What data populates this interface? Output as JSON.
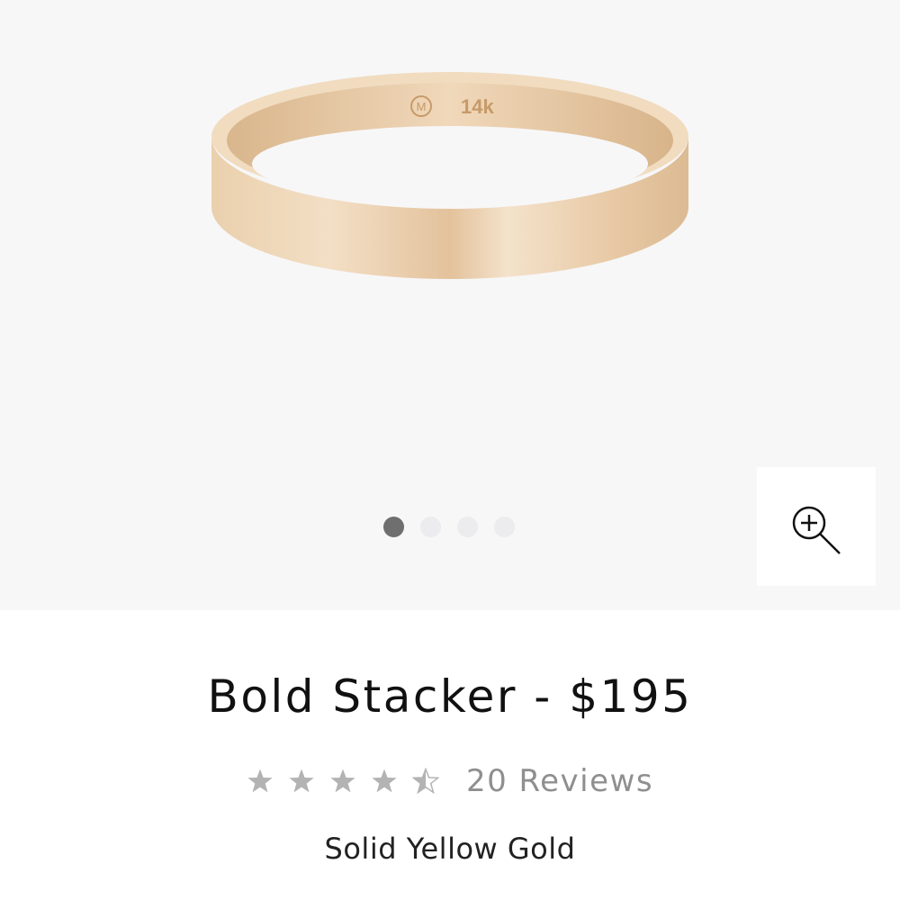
{
  "gallery": {
    "engraving": {
      "logo": "M",
      "karat": "14k"
    },
    "dots": [
      {
        "label": "Image 1",
        "active": true
      },
      {
        "label": "Image 2",
        "active": false
      },
      {
        "label": "Image 3",
        "active": false
      },
      {
        "label": "Image 4",
        "active": false
      }
    ],
    "zoom_icon": "zoom-in-icon"
  },
  "product": {
    "title": "Bold Stacker - $195",
    "rating": 4.5,
    "max_rating": 5,
    "reviews_label": "20 Reviews",
    "variant": "Solid Yellow Gold"
  },
  "colors": {
    "gallery_bg": "#f7f7f8",
    "gold": "#e9c9a1",
    "star": "#b3b3b3",
    "active_dot": "#6f6f6f"
  }
}
